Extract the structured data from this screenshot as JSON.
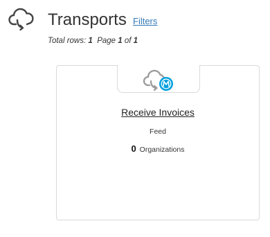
{
  "header": {
    "icon": "cloud-sync-icon",
    "title": "Transports",
    "filters_label": "Filters",
    "summary": {
      "total_rows_label": "Total rows:",
      "total_rows": "1",
      "page_label": "Page",
      "page_current": "1",
      "of_label": "of",
      "page_total": "1"
    }
  },
  "cards": [
    {
      "icon": "cloud-mulesoft-icon",
      "title": "Receive Invoices",
      "type": "Feed",
      "organizations_count": "0",
      "organizations_label": "Organizations"
    }
  ],
  "colors": {
    "link": "#337ab7",
    "mulesoft_badge": "#00a0df",
    "icon_gray": "#9a9a9a",
    "card_border": "#d9d9d9"
  }
}
